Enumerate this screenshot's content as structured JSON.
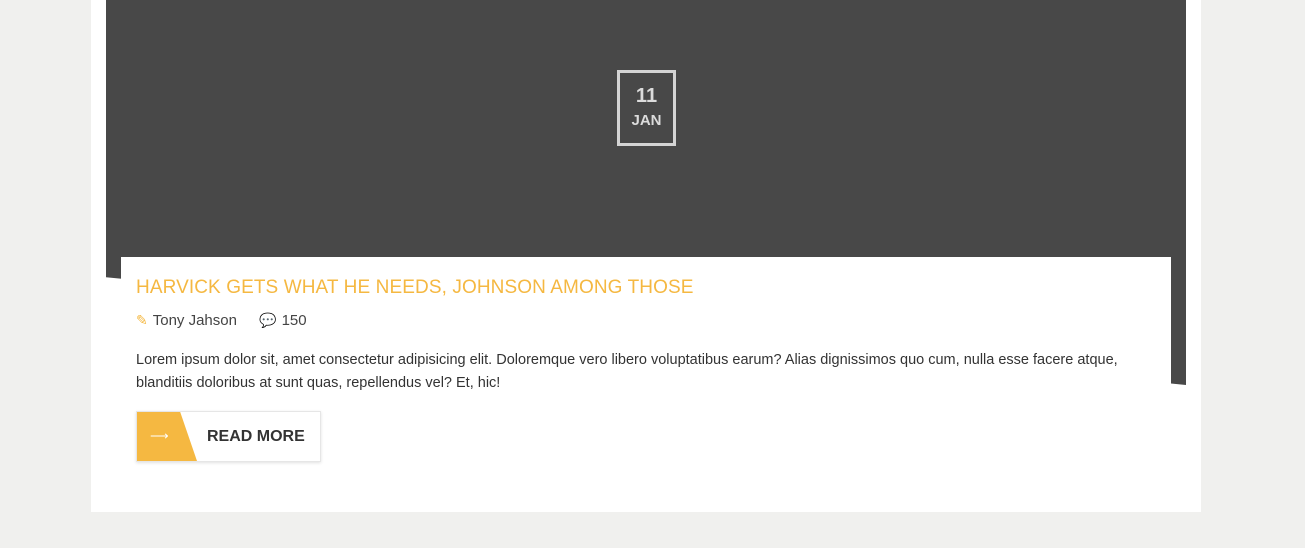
{
  "post": {
    "date": {
      "day": "11",
      "month": "JAN"
    },
    "title": "HARVICK GETS WHAT HE NEEDS, JOHNSON AMONG THOSE",
    "meta": {
      "author": "Tony Jahson",
      "author_icon": "edit-icon",
      "comments": "150",
      "comments_icon": "comments-icon"
    },
    "excerpt": "Lorem ipsum dolor sit, amet consectetur adipisicing elit. Doloremque vero libero voluptatibus earum? Alias dignissimos quo cum, nulla esse facere atque, blanditiis doloribus at sunt quas, repellendus vel? Et, hic!",
    "read_more_label": "READ MORE"
  },
  "colors": {
    "accent": "#f5b841",
    "hero_background": "#484848",
    "page_background": "#f0f0ee"
  }
}
